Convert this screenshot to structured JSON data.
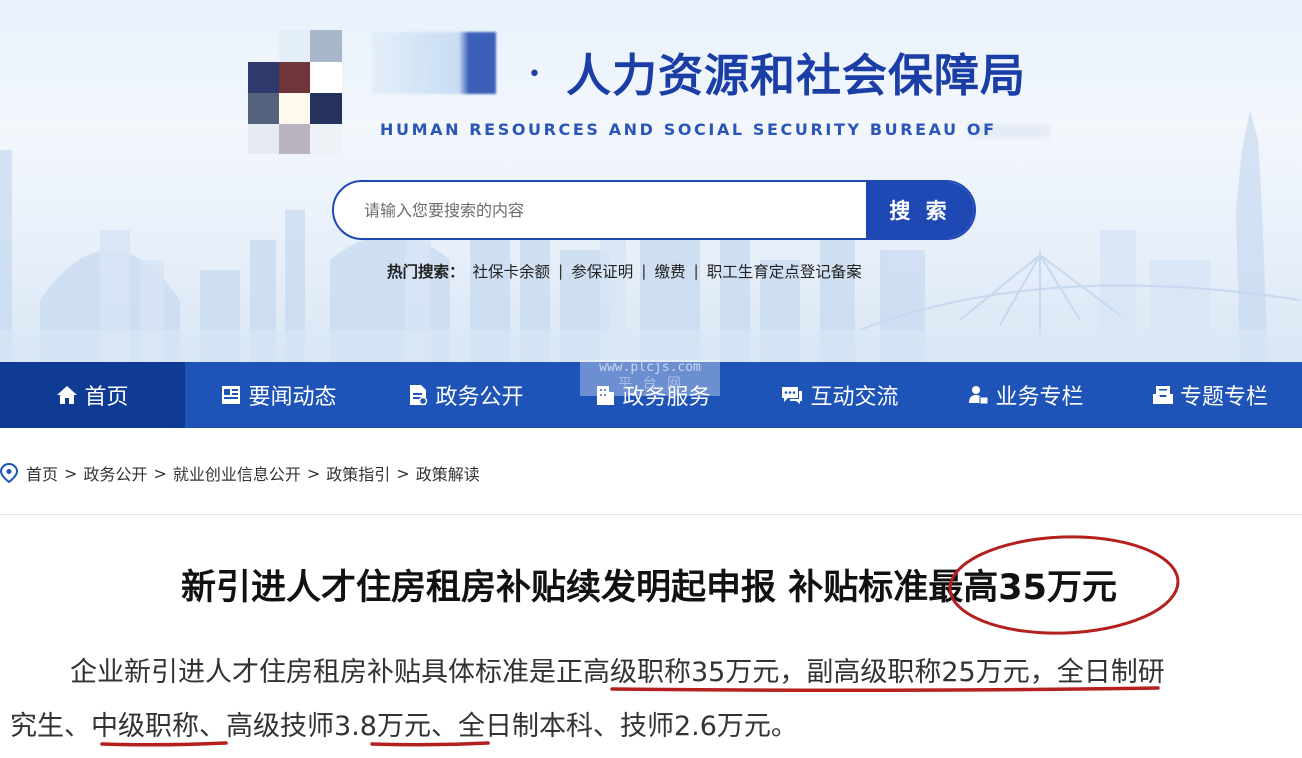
{
  "header": {
    "title_cn": "人力资源和社会保障局",
    "title_en": "HUMAN RESOURCES AND SOCIAL SECURITY BUREAU OF",
    "title_dot": "•"
  },
  "search": {
    "placeholder": "请输入您要搜索的内容",
    "button_label": "搜 索"
  },
  "hot_search": {
    "label": "热门搜索：",
    "items": [
      "社保卡余额",
      "参保证明",
      "缴费",
      "职工生育定点登记备案"
    ],
    "separator": "|"
  },
  "nav": {
    "items": [
      {
        "label": "首页",
        "icon": "home-icon"
      },
      {
        "label": "要闻动态",
        "icon": "news-icon"
      },
      {
        "label": "政务公开",
        "icon": "document-icon"
      },
      {
        "label": "政务服务",
        "icon": "building-icon"
      },
      {
        "label": "互动交流",
        "icon": "chat-icon"
      },
      {
        "label": "业务专栏",
        "icon": "user-card-icon"
      },
      {
        "label": "专题专栏",
        "icon": "inbox-icon"
      }
    ],
    "active_index": 0
  },
  "watermark": {
    "line1": "www.plcjs.com",
    "line2": "平  台  网"
  },
  "breadcrumb": {
    "items": [
      "首页",
      "政务公开",
      "就业创业信息公开",
      "政策指引",
      "政策解读"
    ],
    "separator": ">"
  },
  "article": {
    "title": "新引进人才住房租房补贴续发明起申报 补贴标准最高35万元",
    "body_line1": "企业新引进人才住房租房补贴具体标准是正高级职称35万元，副高级职称25万元，全日制研",
    "body_line2": "究生、中级职称、高级技师3.8万元、全日制本科、技师2.6万元。"
  },
  "colors": {
    "brand_blue": "#1e48b4",
    "nav_blue": "#1e53b8",
    "nav_active": "#0f3b95",
    "annotation_red": "#b3201e"
  }
}
